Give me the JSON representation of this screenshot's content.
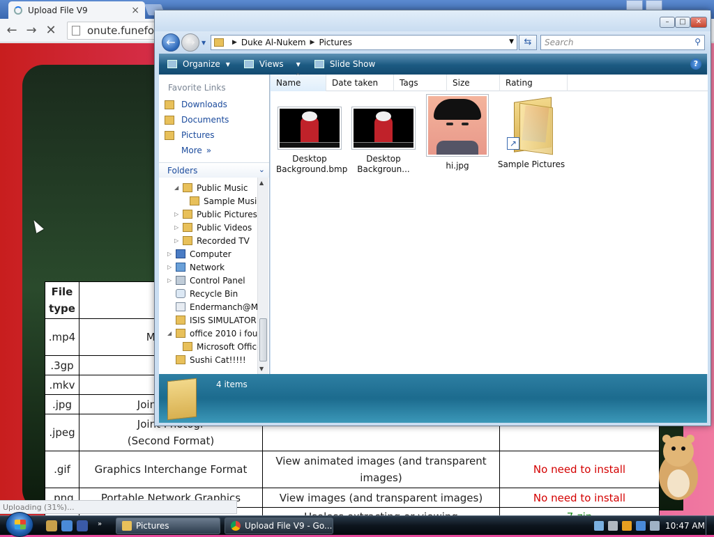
{
  "browser": {
    "tab_title": "Upload File V9",
    "tab_close": "×",
    "url": "onute.funefox.co",
    "back": "←",
    "forward": "→",
    "stop": "✕",
    "status": "Uploading (31%)..."
  },
  "table": {
    "header": [
      "File type",
      "F"
    ],
    "rows": [
      {
        "type": ".mp4",
        "name": "Mpeg4 (e",
        "use": "",
        "req": ""
      },
      {
        "type": ".3gp",
        "name": "A",
        "use": "",
        "req": ""
      },
      {
        "type": ".mkv",
        "name": "M",
        "use": "",
        "req": ""
      },
      {
        "type": ".jpg",
        "name": "Joint Photogr",
        "use": "",
        "req": ""
      },
      {
        "type": ".jpeg",
        "name": "Joint Photogr",
        "name2": "(Second Format)",
        "use": "View small size images",
        "req": "No need to install"
      },
      {
        "type": ".gif",
        "name": "Graphics Interchange Format",
        "use": "View animated images (and transparent",
        "use2": "images)",
        "req": "No need to install"
      },
      {
        "type": ".png",
        "name": "Portable Network Graphics",
        "use": "View images (and transparent images)",
        "req": "No need to install"
      },
      {
        "type": "",
        "name": "",
        "use": "Useless extracting or viewing",
        "req": "7-zip"
      }
    ]
  },
  "explorer": {
    "breadcrumb": [
      "Duke Al-Nukem",
      "Pictures"
    ],
    "search_placeholder": "Search",
    "toolbar": {
      "organize": "Organize",
      "views": "Views",
      "slideshow": "Slide Show"
    },
    "favorite_links_header": "Favorite Links",
    "favorites": [
      "Downloads",
      "Documents",
      "Pictures"
    ],
    "more": "More",
    "folders_header": "Folders",
    "tree": [
      {
        "label": "Public Music",
        "indent": 1,
        "expanded": true,
        "kind": "folder"
      },
      {
        "label": "Sample Music",
        "indent": 2,
        "kind": "folder"
      },
      {
        "label": "Public Pictures",
        "indent": 1,
        "kind": "folder"
      },
      {
        "label": "Public Videos",
        "indent": 1,
        "kind": "folder"
      },
      {
        "label": "Recorded TV",
        "indent": 1,
        "kind": "folder"
      },
      {
        "label": "Computer",
        "indent": 0,
        "kind": "pc"
      },
      {
        "label": "Network",
        "indent": 0,
        "kind": "net"
      },
      {
        "label": "Control Panel",
        "indent": 0,
        "kind": "cp"
      },
      {
        "label": "Recycle Bin",
        "indent": 0,
        "kind": "rb"
      },
      {
        "label": "Endermanch@MEI",
        "indent": 0,
        "kind": "doc"
      },
      {
        "label": "ISIS SIMULATOR",
        "indent": 0,
        "kind": "folder"
      },
      {
        "label": "office 2010 i found",
        "indent": 0,
        "expanded": true,
        "kind": "folder"
      },
      {
        "label": "Microsoft Office",
        "indent": 1,
        "kind": "folder"
      },
      {
        "label": "Sushi Cat!!!!!",
        "indent": 0,
        "kind": "folder"
      }
    ],
    "columns": [
      "Name",
      "Date taken",
      "Tags",
      "Size",
      "Rating"
    ],
    "items": [
      {
        "line1": "Desktop",
        "line2": "Background.bmp"
      },
      {
        "line1": "Desktop",
        "line2": "Backgroun..."
      },
      {
        "line1": "hi.jpg",
        "line2": ""
      },
      {
        "line1": "Sample Pictures",
        "line2": ""
      }
    ],
    "details": "4 items"
  },
  "taskbar": {
    "tasks": [
      "Pictures",
      "Upload File V9 - Go..."
    ],
    "clock": "10:47 AM"
  }
}
